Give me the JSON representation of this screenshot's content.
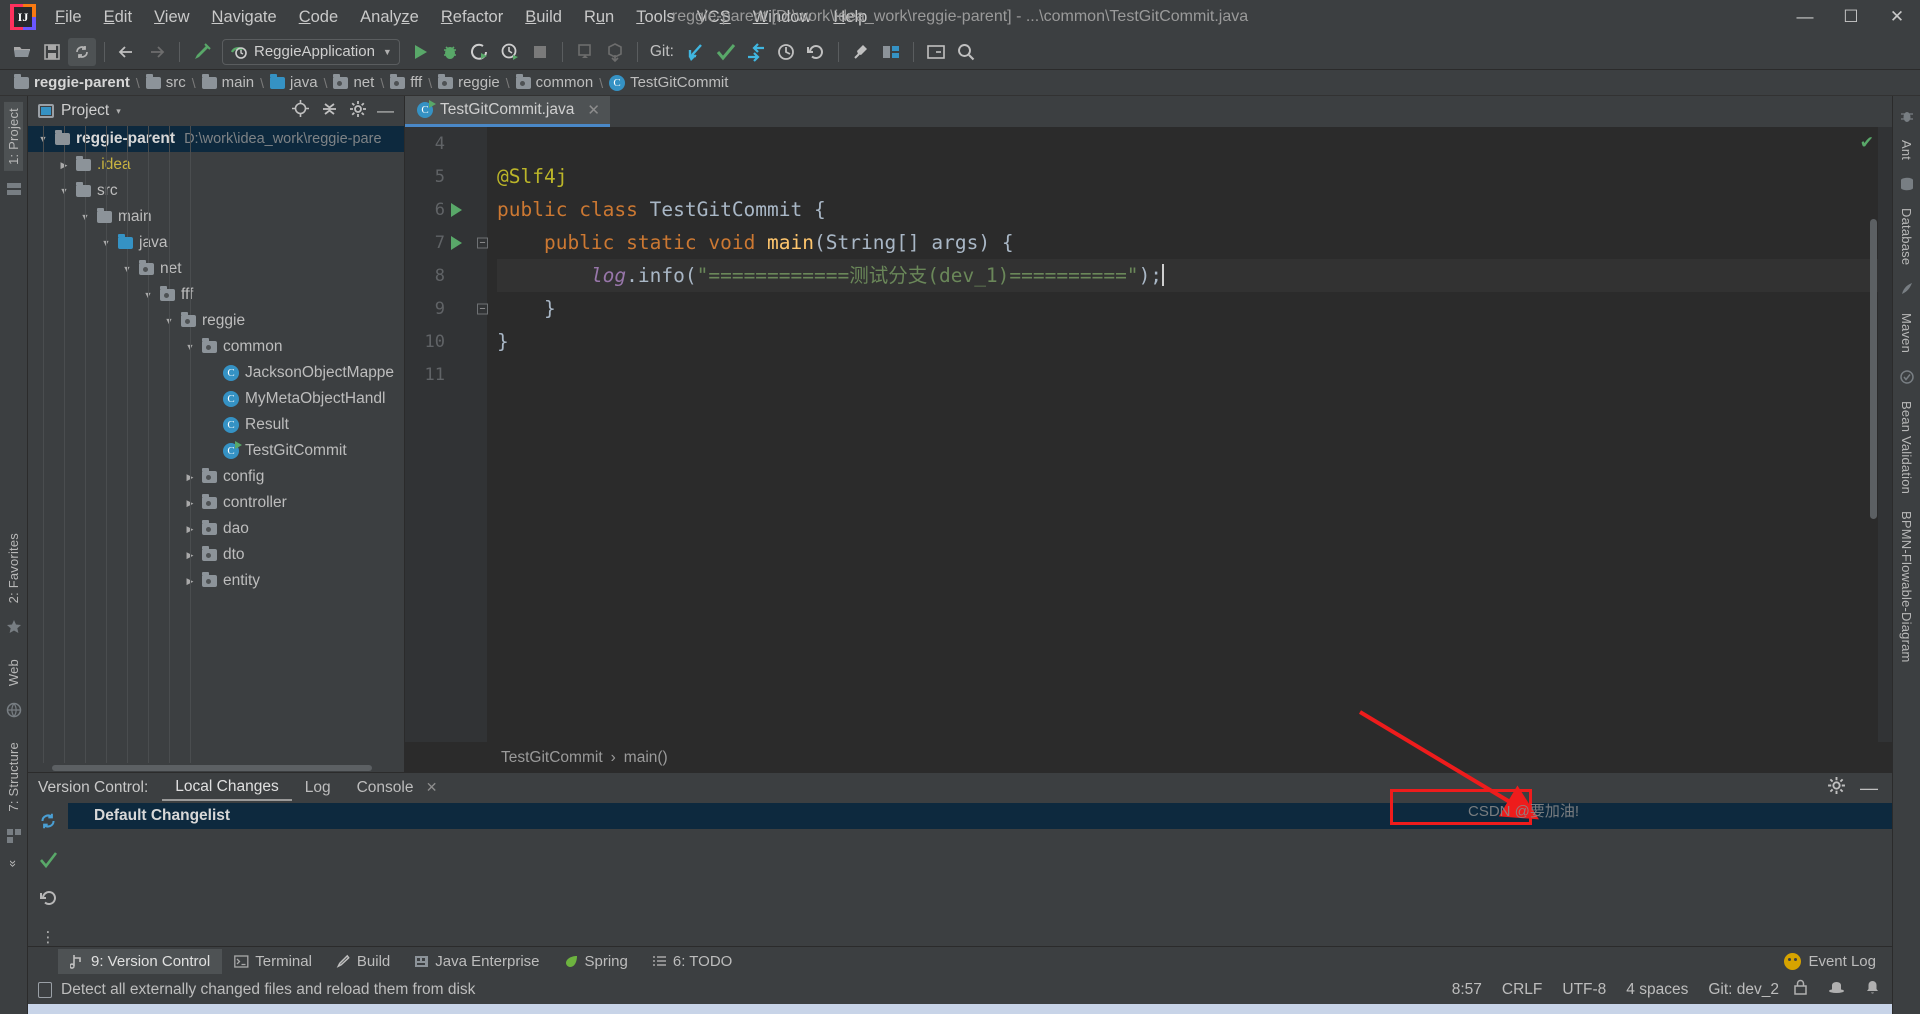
{
  "window": {
    "title": "reggie-parent [D:\\work\\idea_work\\reggie-parent] - ...\\common\\TestGitCommit.java",
    "minimize": "—",
    "maximize": "☐",
    "close": "✕",
    "logo_letters": "IJ"
  },
  "menubar": {
    "items": [
      {
        "label": "File",
        "mnemonic": "F"
      },
      {
        "label": "Edit",
        "mnemonic": "E"
      },
      {
        "label": "View",
        "mnemonic": "V"
      },
      {
        "label": "Navigate",
        "mnemonic": "N"
      },
      {
        "label": "Code",
        "mnemonic": "C"
      },
      {
        "label": "Analyze",
        "mnemonic": "z"
      },
      {
        "label": "Refactor",
        "mnemonic": "R"
      },
      {
        "label": "Build",
        "mnemonic": "B"
      },
      {
        "label": "Run",
        "mnemonic": "u"
      },
      {
        "label": "Tools",
        "mnemonic": "T"
      },
      {
        "label": "VCS",
        "mnemonic": "S"
      },
      {
        "label": "Window",
        "mnemonic": "W"
      },
      {
        "label": "Help",
        "mnemonic": "H"
      }
    ]
  },
  "toolbar": {
    "open_icon": "open-folder-icon",
    "save_icon": "save-icon",
    "sync_icon": "sync-icon",
    "back_icon": "back-arrow-icon",
    "forward_icon": "forward-arrow-icon",
    "build_icon": "build-hammer-icon",
    "run_config": "ReggieApplication",
    "run_icon": "run-icon",
    "debug_icon": "debug-icon",
    "run_coverage_icon": "run-with-coverage-icon",
    "profile_icon": "profiler-icon",
    "stop_icon": "stop-icon",
    "git_label": "Git:",
    "git_update_icon": "git-update-project-icon",
    "git_commit_icon": "git-commit-icon",
    "git_push_icon": "git-push-icon",
    "git_history_icon": "git-history-icon",
    "git_revert_icon": "git-revert-icon",
    "settings_icon": "settings-wrench-icon",
    "project_structure_icon": "project-structure-icon",
    "terminal_icon": "terminal-icon",
    "search_icon": "search-everywhere-icon"
  },
  "breadcrumbs": {
    "items": [
      {
        "label": "reggie-parent",
        "icon": "folder-icon",
        "kind": "module"
      },
      {
        "label": "src",
        "icon": "folder-icon",
        "kind": "folder"
      },
      {
        "label": "main",
        "icon": "folder-icon",
        "kind": "folder"
      },
      {
        "label": "java",
        "icon": "source-folder-icon",
        "kind": "source"
      },
      {
        "label": "net",
        "icon": "package-icon",
        "kind": "package"
      },
      {
        "label": "fff",
        "icon": "package-icon",
        "kind": "package"
      },
      {
        "label": "reggie",
        "icon": "package-icon",
        "kind": "package"
      },
      {
        "label": "common",
        "icon": "package-icon",
        "kind": "package"
      },
      {
        "label": "TestGitCommit",
        "icon": "class-icon",
        "kind": "class"
      }
    ],
    "separator": "›"
  },
  "left_toolwindows": [
    {
      "label": "1: Project",
      "active": true
    },
    {
      "label": "2: Favorites",
      "active": false
    },
    {
      "label": "Web",
      "active": false
    },
    {
      "label": "7: Structure",
      "active": false
    },
    {
      "label": "»",
      "active": false
    }
  ],
  "right_toolwindows": [
    {
      "label": "Ant"
    },
    {
      "label": "Database"
    },
    {
      "label": "Maven"
    },
    {
      "label": "Bean Validation"
    },
    {
      "label": "BPMN-Flowable-Diagram"
    }
  ],
  "project_panel": {
    "title": "Project",
    "caret": "▾",
    "locate_icon": "locate-target-icon",
    "collapse_icon": "collapse-all-icon",
    "settings_icon": "gear-icon",
    "hide_icon": "hide-panel-icon",
    "tree": [
      {
        "label": "reggie-parent",
        "path": "D:\\work\\idea_work\\reggie-pare",
        "depth": 0,
        "twisty": "▼",
        "icon": "module-folder-icon",
        "bold": true,
        "selected": true
      },
      {
        "label": ".idea",
        "depth": 1,
        "twisty": "▶",
        "icon": "folder-icon",
        "yellow": true
      },
      {
        "label": "src",
        "depth": 1,
        "twisty": "▼",
        "icon": "folder-icon"
      },
      {
        "label": "main",
        "depth": 2,
        "twisty": "▼",
        "icon": "folder-icon"
      },
      {
        "label": "java",
        "depth": 3,
        "twisty": "▼",
        "icon": "source-folder-icon"
      },
      {
        "label": "net",
        "depth": 4,
        "twisty": "▼",
        "icon": "package-icon"
      },
      {
        "label": "fff",
        "depth": 5,
        "twisty": "▼",
        "icon": "package-icon"
      },
      {
        "label": "reggie",
        "depth": 6,
        "twisty": "▼",
        "icon": "package-icon"
      },
      {
        "label": "common",
        "depth": 7,
        "twisty": "▼",
        "icon": "package-icon"
      },
      {
        "label": "JacksonObjectMappe",
        "depth": 8,
        "twisty": "",
        "icon": "class-icon"
      },
      {
        "label": "MyMetaObjectHandl",
        "depth": 8,
        "twisty": "",
        "icon": "class-icon"
      },
      {
        "label": "Result",
        "depth": 8,
        "twisty": "",
        "icon": "class-icon"
      },
      {
        "label": "TestGitCommit",
        "depth": 8,
        "twisty": "",
        "icon": "runnable-class-icon"
      },
      {
        "label": "config",
        "depth": 7,
        "twisty": "▶",
        "icon": "package-icon"
      },
      {
        "label": "controller",
        "depth": 7,
        "twisty": "▶",
        "icon": "package-icon"
      },
      {
        "label": "dao",
        "depth": 7,
        "twisty": "▶",
        "icon": "package-icon"
      },
      {
        "label": "dto",
        "depth": 7,
        "twisty": "▶",
        "icon": "package-icon"
      },
      {
        "label": "entity",
        "depth": 7,
        "twisty": "▶",
        "icon": "package-icon"
      }
    ]
  },
  "editor": {
    "tab": {
      "label": "TestGitCommit.java",
      "icon": "runnable-class-icon",
      "close": "✕"
    },
    "lines": [
      {
        "num": "4",
        "runmark": false,
        "fold": "",
        "tokens": []
      },
      {
        "num": "5",
        "runmark": false,
        "fold": "",
        "tokens": [
          {
            "t": "@Slf4j",
            "c": "a"
          }
        ]
      },
      {
        "num": "6",
        "runmark": true,
        "fold": "",
        "tokens": [
          {
            "t": "public ",
            "c": "k"
          },
          {
            "t": "class ",
            "c": "k"
          },
          {
            "t": "TestGitCommit ",
            "c": "t"
          },
          {
            "t": "{",
            "c": "p"
          }
        ]
      },
      {
        "num": "7",
        "runmark": true,
        "fold": "−",
        "tokens": [
          {
            "t": "    ",
            "c": "p"
          },
          {
            "t": "public ",
            "c": "k"
          },
          {
            "t": "static ",
            "c": "k"
          },
          {
            "t": "void ",
            "c": "k"
          },
          {
            "t": "main",
            "c": "m"
          },
          {
            "t": "(String[] args) {",
            "c": "p"
          }
        ]
      },
      {
        "num": "8",
        "runmark": false,
        "fold": "",
        "current": true,
        "tokens": [
          {
            "t": "        ",
            "c": "p"
          },
          {
            "t": "log",
            "c": "f"
          },
          {
            "t": ".info(",
            "c": "p"
          },
          {
            "t": "\"============测试分支(dev_1)==========\"",
            "c": "s"
          },
          {
            "t": ");",
            "c": "p"
          }
        ]
      },
      {
        "num": "9",
        "runmark": false,
        "fold": "−",
        "tokens": [
          {
            "t": "    }",
            "c": "p"
          }
        ]
      },
      {
        "num": "10",
        "runmark": false,
        "fold": "",
        "tokens": [
          {
            "t": "}",
            "c": "p"
          }
        ]
      },
      {
        "num": "11",
        "runmark": false,
        "fold": "",
        "tokens": []
      }
    ],
    "inspection_status": "✔",
    "bottom_breadcrumb": [
      "TestGitCommit",
      "main()"
    ],
    "bottom_breadcrumb_sep": "›"
  },
  "version_control": {
    "title": "Version Control:",
    "tabs": [
      {
        "label": "Local Changes",
        "active": true,
        "closable": false
      },
      {
        "label": "Log",
        "active": false,
        "closable": false
      },
      {
        "label": "Console",
        "active": false,
        "closable": true,
        "close": "✕"
      }
    ],
    "refresh_icon": "refresh-icon",
    "commit_icon": "commit-checkmark-icon",
    "rollback_icon": "rollback-icon",
    "settings_icon": "gear-icon",
    "hide_icon": "hide-panel-icon",
    "changelist": "Default Changelist"
  },
  "bottom_tabs": [
    {
      "label": "9: Version Control",
      "mnemonic": "9",
      "icon": "version-control-icon",
      "active": true
    },
    {
      "label": "Terminal",
      "mnemonic": "",
      "icon": "terminal-icon",
      "active": false
    },
    {
      "label": "Build",
      "mnemonic": "",
      "icon": "build-hammer-icon",
      "active": false
    },
    {
      "label": "Java Enterprise",
      "mnemonic": "",
      "icon": "java-enterprise-icon",
      "active": false
    },
    {
      "label": "Spring",
      "mnemonic": "",
      "icon": "spring-leaf-icon",
      "active": false
    },
    {
      "label": "6: TODO",
      "mnemonic": "6",
      "icon": "todo-list-icon",
      "active": false
    }
  ],
  "event_log": {
    "label": "Event Log",
    "icon": "event-log-icon"
  },
  "statusbar": {
    "message": "Detect all externally changed files and reload them from disk",
    "message_icon": "document-icon",
    "position": "8:57",
    "line_separator": "CRLF",
    "encoding": "UTF-8",
    "indent": "4 spaces",
    "git_branch": "Git: dev_2",
    "lock_icon": "read-only-lock-icon",
    "inspector_icon": "inspector-hat-icon",
    "notification_icon": "notification-icon"
  },
  "annotation": {
    "highlight_color": "#ee1c1c",
    "watermark": "CSDN @要加油!"
  }
}
